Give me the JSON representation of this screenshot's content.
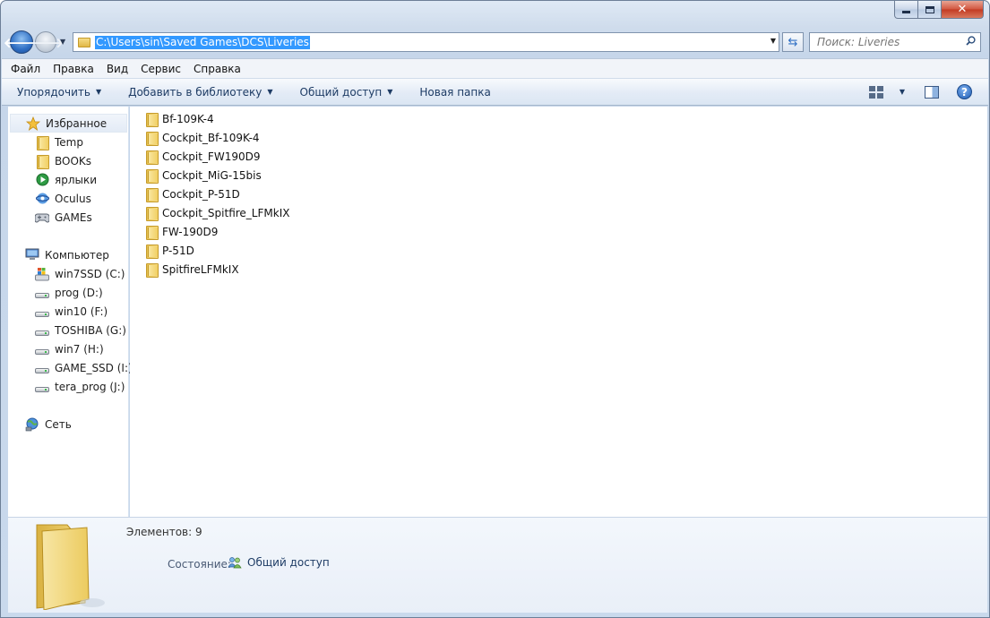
{
  "window": {
    "address_path": "C:\\Users\\sin\\Saved Games\\DCS\\Liveries",
    "search_placeholder": "Поиск: Liveries"
  },
  "menu": [
    {
      "label": "Файл"
    },
    {
      "label": "Правка"
    },
    {
      "label": "Вид"
    },
    {
      "label": "Сервис"
    },
    {
      "label": "Справка"
    }
  ],
  "toolbar": {
    "organize": "Упорядочить",
    "add_library": "Добавить в библиотеку",
    "share": "Общий доступ",
    "new_folder": "Новая папка"
  },
  "nav": {
    "favorites": {
      "label": "Избранное",
      "items": [
        {
          "label": "Temp",
          "icon": "folder-icon"
        },
        {
          "label": "BOOKs",
          "icon": "folder-icon"
        },
        {
          "label": "ярлыки",
          "icon": "shortcut-icon"
        },
        {
          "label": "Oculus",
          "icon": "oculus-icon"
        },
        {
          "label": "GAMEs",
          "icon": "gamepad-icon"
        }
      ]
    },
    "computer": {
      "label": "Компьютер",
      "drives": [
        {
          "label": "win7SSD (C:)"
        },
        {
          "label": "prog (D:)"
        },
        {
          "label": "win10 (F:)"
        },
        {
          "label": "TOSHIBA (G:)"
        },
        {
          "label": "win7 (H:)"
        },
        {
          "label": "GAME_SSD (I:)"
        },
        {
          "label": "tera_prog (J:)"
        }
      ]
    },
    "network": {
      "label": "Сеть"
    }
  },
  "files": [
    {
      "name": "Bf-109K-4"
    },
    {
      "name": "Cockpit_Bf-109K-4"
    },
    {
      "name": "Cockpit_FW190D9"
    },
    {
      "name": "Cockpit_MiG-15bis"
    },
    {
      "name": "Cockpit_P-51D"
    },
    {
      "name": "Cockpit_Spitfire_LFMkIX"
    },
    {
      "name": "FW-190D9"
    },
    {
      "name": "P-51D"
    },
    {
      "name": "SpitfireLFMkIX"
    }
  ],
  "details": {
    "elements": "Элементов: 9",
    "state_label": "Состояние:",
    "state_value": "Общий доступ"
  },
  "colors": {
    "selection": "#3399ff",
    "accent": "#1e3c65"
  }
}
